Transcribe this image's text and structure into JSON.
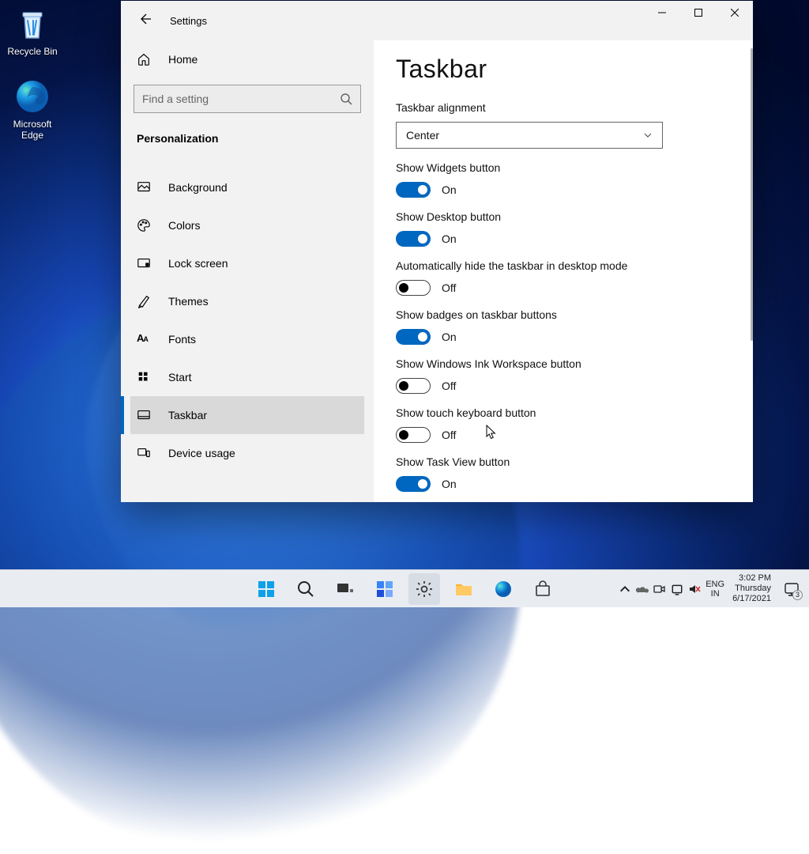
{
  "desktop": {
    "icons": [
      {
        "name": "Recycle Bin"
      },
      {
        "name": "Microsoft Edge"
      }
    ]
  },
  "window": {
    "title": "Settings"
  },
  "sidebar": {
    "home": "Home",
    "search_placeholder": "Find a setting",
    "section": "Personalization",
    "items": [
      {
        "label": "Background"
      },
      {
        "label": "Colors"
      },
      {
        "label": "Lock screen"
      },
      {
        "label": "Themes"
      },
      {
        "label": "Fonts"
      },
      {
        "label": "Start"
      },
      {
        "label": "Taskbar"
      },
      {
        "label": "Device usage"
      }
    ]
  },
  "panel": {
    "heading": "Taskbar",
    "alignment": {
      "label": "Taskbar alignment",
      "value": "Center"
    },
    "toggles": [
      {
        "label": "Show Widgets button",
        "state": "On"
      },
      {
        "label": "Show Desktop button",
        "state": "On"
      },
      {
        "label": "Automatically hide the taskbar in desktop mode",
        "state": "Off"
      },
      {
        "label": "Show badges on taskbar buttons",
        "state": "On"
      },
      {
        "label": "Show Windows Ink Workspace button",
        "state": "Off"
      },
      {
        "label": "Show touch keyboard button",
        "state": "Off"
      },
      {
        "label": "Show Task View button",
        "state": "On"
      }
    ]
  },
  "systray": {
    "lang1": "ENG",
    "lang2": "IN",
    "time": "3:02 PM",
    "day": "Thursday",
    "date": "6/17/2021",
    "notif_count": "3"
  }
}
